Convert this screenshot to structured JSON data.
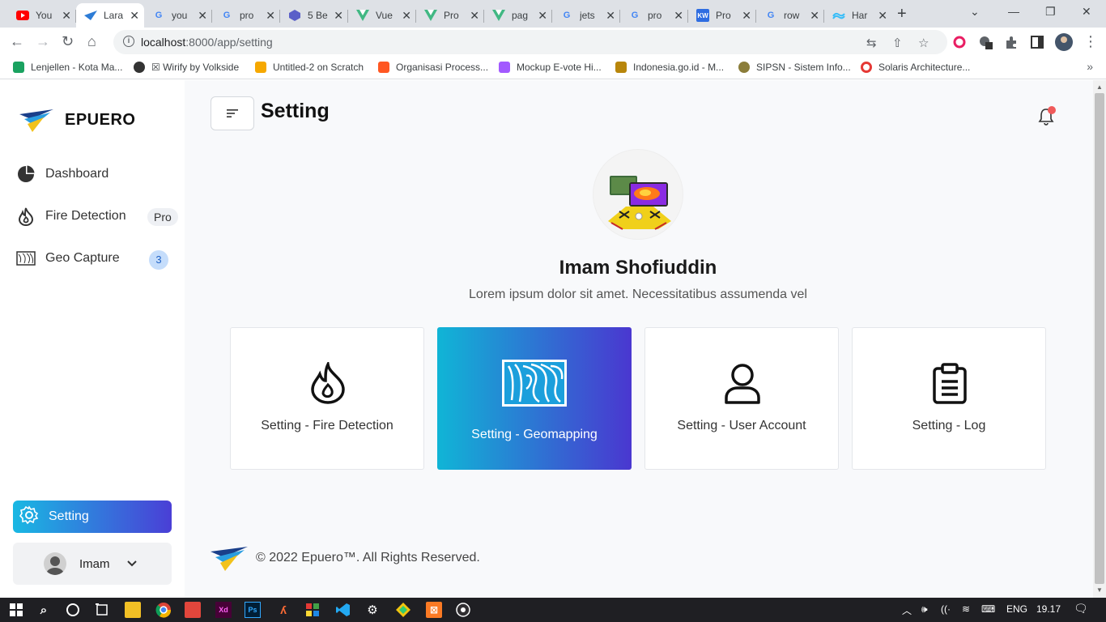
{
  "browser": {
    "tabs": [
      {
        "title": "You",
        "favicon": "youtube-icon",
        "color": "#ff0000"
      },
      {
        "title": "Lara",
        "favicon": "epuero-logo-icon",
        "color": "#2d7cd6"
      },
      {
        "title": "you",
        "favicon": "google-icon",
        "color": "#4285f4"
      },
      {
        "title": "pro",
        "favicon": "google-icon",
        "color": "#4285f4"
      },
      {
        "title": "5 Be",
        "favicon": "hexagon-icon",
        "color": "#5a5fc8"
      },
      {
        "title": "Vue",
        "favicon": "vue-icon",
        "color": "#41b883"
      },
      {
        "title": "Pro",
        "favicon": "vue-icon",
        "color": "#41b883"
      },
      {
        "title": "pag",
        "favicon": "vue-icon",
        "color": "#41b883"
      },
      {
        "title": "jets",
        "favicon": "google-icon",
        "color": "#4285f4"
      },
      {
        "title": "pro",
        "favicon": "google-icon",
        "color": "#4285f4"
      },
      {
        "title": "Pro",
        "favicon": "kw-icon",
        "color": "#2f6de1"
      },
      {
        "title": "row",
        "favicon": "google-icon",
        "color": "#4285f4"
      },
      {
        "title": "Har",
        "favicon": "tailwind-icon",
        "color": "#38bdf8"
      }
    ],
    "url_host": "localhost",
    "url_path": ":8000/app/setting",
    "bookmarks": [
      {
        "label": "Lenjellen - Kota Ma...",
        "color": "#1aa260"
      },
      {
        "label": "☒ Wirify by Volkside",
        "color": "#333333"
      },
      {
        "label": "Untitled-2 on Scratch",
        "color": "#f6a800"
      },
      {
        "label": "Organisasi Process...",
        "color": "#ff5722"
      },
      {
        "label": "Mockup E-vote Hi...",
        "color": "#a259ff"
      },
      {
        "label": "Indonesia.go.id - M...",
        "color": "#b8860b"
      },
      {
        "label": "SIPSN - Sistem Info...",
        "color": "#8b7d3a"
      },
      {
        "label": "Solaris Architecture...",
        "color": "#e53935"
      }
    ]
  },
  "app": {
    "brand": "EPUERO",
    "page_title": "Setting",
    "menu": [
      {
        "label": "Dashboard",
        "icon": "pie-chart-icon"
      },
      {
        "label": "Fire Detection",
        "icon": "flame-icon",
        "badge": "Pro"
      },
      {
        "label": "Geo Capture",
        "icon": "map-icon",
        "badge": "3"
      }
    ],
    "active_menu": "Setting",
    "user": {
      "name": "Imam"
    },
    "profile": {
      "name": "Imam Shofiuddin",
      "bio": "Lorem ipsum dolor sit amet. Necessitatibus assumenda vel"
    },
    "cards": [
      {
        "label": "Setting - Fire Detection",
        "icon": "flame-icon",
        "active": false
      },
      {
        "label": "Setting - Geomapping",
        "icon": "topographic-map-icon",
        "active": true
      },
      {
        "label": "Setting - User Account",
        "icon": "user-icon",
        "active": false
      },
      {
        "label": "Setting - Log",
        "icon": "clipboard-icon",
        "active": false
      }
    ],
    "footer": "© 2022 Epuero™. All Rights Reserved.",
    "colors": {
      "gradient_start": "#19b8e3",
      "gradient_end": "#4a3fd6",
      "notification_dot": "#f05a5a"
    }
  },
  "taskbar": {
    "language": "ENG",
    "time": "19.17"
  }
}
